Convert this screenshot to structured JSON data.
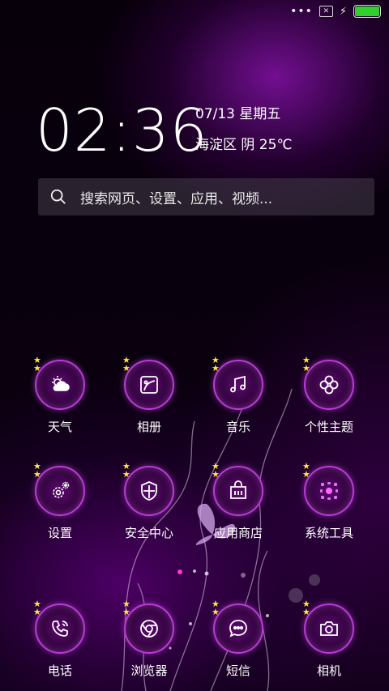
{
  "status_bar": {
    "dots": "•••",
    "sim_icon": "sim-x-icon",
    "charging_icon": "bolt-icon",
    "battery_color": "#31d12d",
    "battery_level": 1.0
  },
  "lockscreen": {
    "time": "02:36",
    "date": "07/13  星期五",
    "weather": "海淀区  阴  25℃"
  },
  "search": {
    "placeholder": "搜索网页、设置、应用、视频..."
  },
  "apps": [
    {
      "label": "天气",
      "icon": "weather-icon"
    },
    {
      "label": "相册",
      "icon": "gallery-icon"
    },
    {
      "label": "音乐",
      "icon": "music-icon"
    },
    {
      "label": "个性主题",
      "icon": "theme-icon"
    },
    {
      "label": "设置",
      "icon": "settings-icon"
    },
    {
      "label": "安全中心",
      "icon": "security-icon"
    },
    {
      "label": "应用商店",
      "icon": "app-store-icon"
    },
    {
      "label": "系统工具",
      "icon": "system-tools-icon"
    },
    {
      "label": "电话",
      "icon": "phone-icon"
    },
    {
      "label": "浏览器",
      "icon": "browser-icon"
    },
    {
      "label": "短信",
      "icon": "messages-icon"
    },
    {
      "label": "相机",
      "icon": "camera-icon"
    }
  ],
  "colors": {
    "accent": "#b93bd6",
    "star": "#ffe640"
  }
}
